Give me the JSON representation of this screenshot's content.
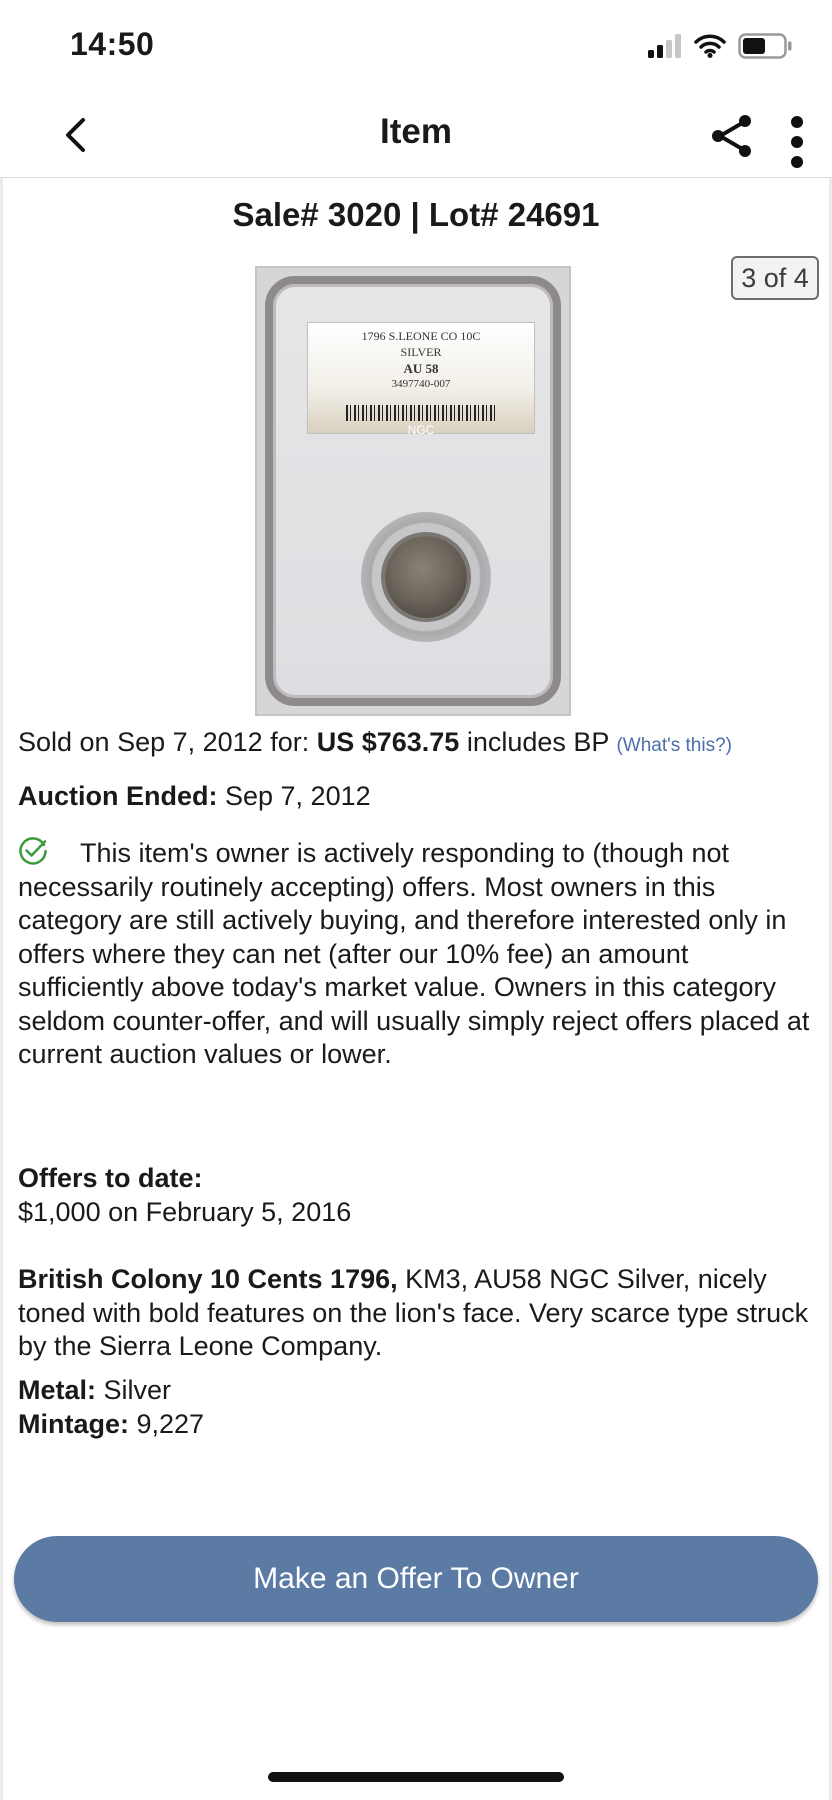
{
  "status_bar": {
    "time": "14:50"
  },
  "nav": {
    "title": "Item",
    "back_icon": "chevron-left-icon",
    "share_icon": "share-icon",
    "more_icon": "more-vertical-icon"
  },
  "item": {
    "sale_lot": "Sale# 3020 | Lot# 24691",
    "image_counter": "3 of 4",
    "slab_label": {
      "line1": "1796 S.LEONE CO 10C",
      "line2": "SILVER",
      "line3": "AU 58",
      "line4": "3497740-007",
      "brand": "NGC"
    },
    "sold": {
      "prefix": "Sold on Sep 7, 2012 for: ",
      "price": "US $763.75",
      "suffix": " includes BP ",
      "help_link": "(What's this?)"
    },
    "auction": {
      "label": "Auction Ended:",
      "value": " Sep 7, 2012"
    },
    "owner_notice": "This item's owner is actively responding to (though not necessarily routinely accepting) offers. Most owners in this category are still actively buying, and therefore interested only in offers where they can net (after our 10% fee) an amount sufficiently above today's market value. Owners in this category seldom counter-offer, and will usually simply reject offers placed at current auction values or lower.",
    "offers": {
      "label": "Offers to date:",
      "value": "$1,000 on February  5, 2016"
    },
    "description": {
      "title": "British Colony 10 Cents 1796,",
      "body": " KM3, AU58 NGC Silver, nicely toned with bold features on the lion's face. Very scarce type struck by the Sierra Leone Company."
    },
    "metal": {
      "label": "Metal:",
      "value": " Silver"
    },
    "mintage": {
      "label": "Mintage:",
      "value": " 9,227"
    }
  },
  "actions": {
    "offer_button": "Make an Offer To Owner"
  },
  "colors": {
    "button": "#5b7ba5",
    "link": "#4a6fa8",
    "check": "#3d9a3d"
  }
}
